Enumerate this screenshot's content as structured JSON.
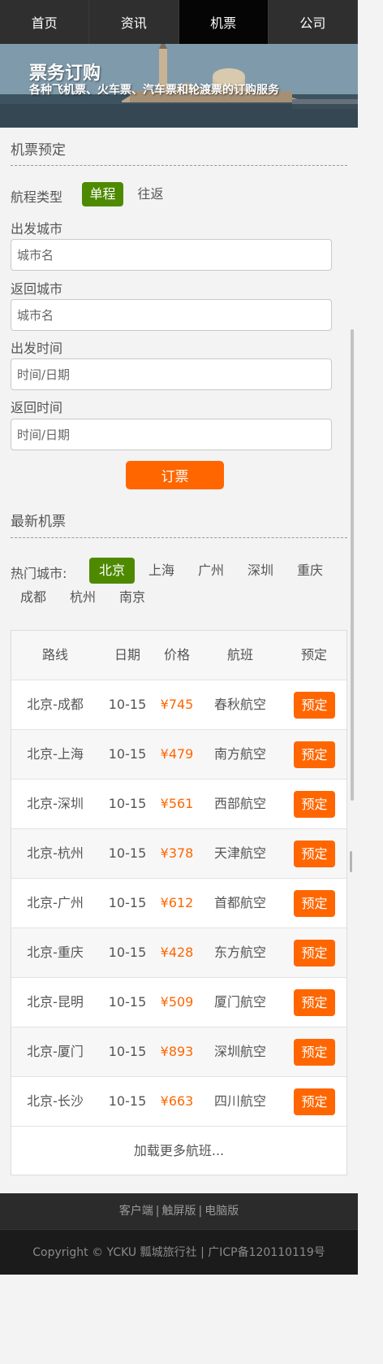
{
  "nav": [
    {
      "label": "首页",
      "active": false
    },
    {
      "label": "资讯",
      "active": false
    },
    {
      "label": "机票",
      "active": true
    },
    {
      "label": "公司",
      "active": false
    }
  ],
  "banner": {
    "title": "票务订购",
    "subtitle": "各种飞机票、火车票、汽车票和轮渡票的订购服务"
  },
  "booking": {
    "section_title": "机票预定",
    "trip_type_label": "航程类型",
    "trip_options": [
      {
        "label": "单程",
        "selected": true
      },
      {
        "label": "往返",
        "selected": false
      }
    ],
    "fields": [
      {
        "label": "出发城市",
        "placeholder": "城市名"
      },
      {
        "label": "返回城市",
        "placeholder": "城市名"
      },
      {
        "label": "出发时间",
        "placeholder": "时间/日期"
      },
      {
        "label": "返回时间",
        "placeholder": "时间/日期"
      }
    ],
    "submit_label": "订票"
  },
  "latest": {
    "section_title": "最新机票",
    "hot_label": "热门城市:",
    "cities": [
      {
        "label": "北京",
        "selected": true
      },
      {
        "label": "上海",
        "selected": false
      },
      {
        "label": "广州",
        "selected": false
      },
      {
        "label": "深圳",
        "selected": false
      },
      {
        "label": "重庆",
        "selected": false
      },
      {
        "label": "成都",
        "selected": false
      },
      {
        "label": "杭州",
        "selected": false
      },
      {
        "label": "南京",
        "selected": false
      }
    ],
    "columns": [
      "路线",
      "日期",
      "价格",
      "航班",
      "预定"
    ],
    "rows": [
      {
        "route": "北京-成都",
        "date": "10-15",
        "price": "¥745",
        "airline": "春秋航空",
        "action": "预定"
      },
      {
        "route": "北京-上海",
        "date": "10-15",
        "price": "¥479",
        "airline": "南方航空",
        "action": "预定"
      },
      {
        "route": "北京-深圳",
        "date": "10-15",
        "price": "¥561",
        "airline": "西部航空",
        "action": "预定"
      },
      {
        "route": "北京-杭州",
        "date": "10-15",
        "price": "¥378",
        "airline": "天津航空",
        "action": "预定"
      },
      {
        "route": "北京-广州",
        "date": "10-15",
        "price": "¥612",
        "airline": "首都航空",
        "action": "预定"
      },
      {
        "route": "北京-重庆",
        "date": "10-15",
        "price": "¥428",
        "airline": "东方航空",
        "action": "预定"
      },
      {
        "route": "北京-昆明",
        "date": "10-15",
        "price": "¥509",
        "airline": "厦门航空",
        "action": "预定"
      },
      {
        "route": "北京-厦门",
        "date": "10-15",
        "price": "¥893",
        "airline": "深圳航空",
        "action": "预定"
      },
      {
        "route": "北京-长沙",
        "date": "10-15",
        "price": "¥663",
        "airline": "四川航空",
        "action": "预定"
      }
    ],
    "load_more": "加载更多航班..."
  },
  "footer": {
    "links": [
      "客户端",
      "触屏版",
      "电脑版"
    ],
    "separator": "|",
    "copyright": "Copyright © YCKU 瓢城旅行社 | 广ICP备120110119号"
  },
  "colors": {
    "accent": "#ff6600",
    "selected": "#4e8a00",
    "nav_bg": "#2f2f2f",
    "nav_active": "#050505"
  }
}
